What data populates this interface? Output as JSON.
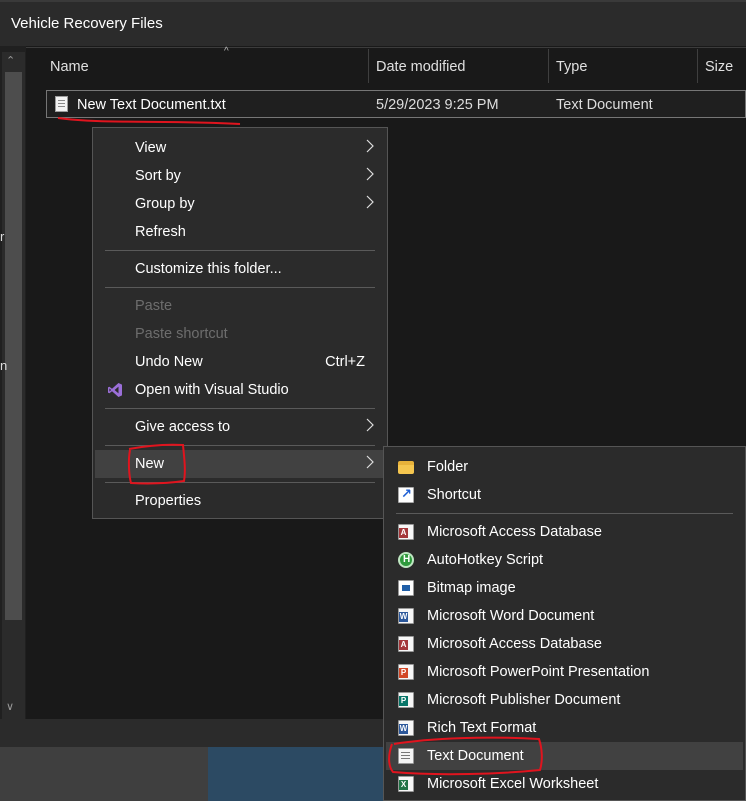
{
  "window": {
    "title": "Vehicle Recovery Files"
  },
  "left_pane": {
    "cut_chars": [
      "r",
      "n"
    ],
    "scroll_down_glyph": "∨"
  },
  "header": {
    "columns": [
      {
        "label": "Name"
      },
      {
        "label": "Date modified"
      },
      {
        "label": "Type"
      },
      {
        "label": "Size"
      }
    ],
    "sort_glyph": "^"
  },
  "files": [
    {
      "name": "New Text Document.txt",
      "date_modified": "5/29/2023 9:25 PM",
      "type": "Text Document",
      "icon": "text-file-icon"
    }
  ],
  "context_menu": {
    "items": [
      {
        "label": "View",
        "submenu": true
      },
      {
        "label": "Sort by",
        "submenu": true
      },
      {
        "label": "Group by",
        "submenu": true
      },
      {
        "label": "Refresh"
      },
      {
        "label": "Customize this folder..."
      },
      {
        "label": "Paste",
        "disabled": true
      },
      {
        "label": "Paste shortcut",
        "disabled": true
      },
      {
        "label": "Undo New",
        "shortcut": "Ctrl+Z"
      },
      {
        "label": "Open with Visual Studio",
        "icon": "visual-studio-icon"
      },
      {
        "label": "Give access to",
        "submenu": true
      },
      {
        "label": "New",
        "submenu": true,
        "active": true
      },
      {
        "label": "Properties"
      }
    ]
  },
  "new_submenu": {
    "items": [
      {
        "label": "Folder",
        "icon": "folder-icon"
      },
      {
        "label": "Shortcut",
        "icon": "shortcut-icon"
      },
      {
        "label": "Microsoft Access Database",
        "icon": "access-icon",
        "tag": "A",
        "color": "#a4373a"
      },
      {
        "label": "AutoHotkey Script",
        "icon": "autohotkey-icon"
      },
      {
        "label": "Bitmap image",
        "icon": "bitmap-icon"
      },
      {
        "label": "Microsoft Word Document",
        "icon": "word-icon",
        "tag": "W",
        "color": "#2b579a"
      },
      {
        "label": "Microsoft Access Database",
        "icon": "access-icon",
        "tag": "A",
        "color": "#a4373a"
      },
      {
        "label": "Microsoft PowerPoint Presentation",
        "icon": "powerpoint-icon",
        "tag": "P",
        "color": "#d24726"
      },
      {
        "label": "Microsoft Publisher Document",
        "icon": "publisher-icon",
        "tag": "P",
        "color": "#077568"
      },
      {
        "label": "Rich Text Format",
        "icon": "rtf-icon",
        "tag": "W",
        "color": "#2b579a"
      },
      {
        "label": "Text Document",
        "icon": "text-document-icon",
        "active": true
      },
      {
        "label": "Microsoft Excel Worksheet",
        "icon": "excel-icon",
        "tag": "X",
        "color": "#217346"
      }
    ]
  },
  "colors": {
    "menu_bg": "#2b2b2b",
    "hover_bg": "#414141",
    "annotation_red": "#e0141e",
    "disabled_text": "#6d6d6d"
  }
}
